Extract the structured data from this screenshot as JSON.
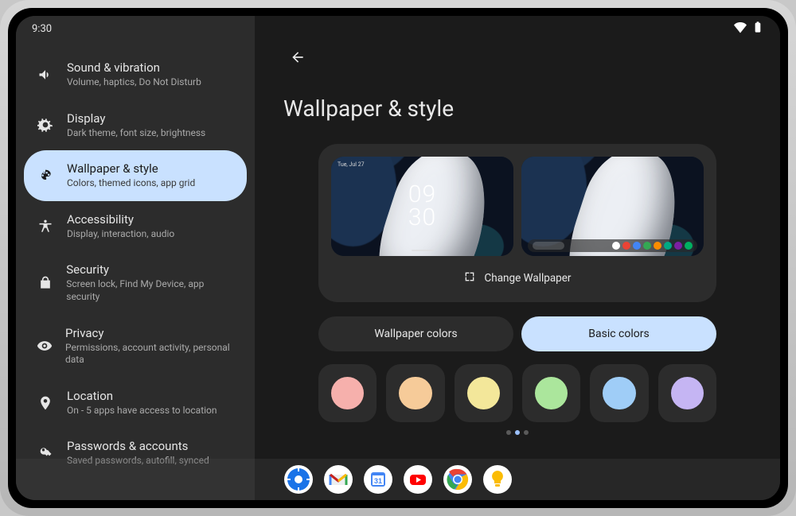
{
  "status": {
    "time": "9:30"
  },
  "sidebar": {
    "items": [
      {
        "key": "sound",
        "title": "Sound & vibration",
        "subtitle": "Volume, haptics, Do Not Disturb"
      },
      {
        "key": "display",
        "title": "Display",
        "subtitle": "Dark theme, font size, brightness"
      },
      {
        "key": "wallpaper",
        "title": "Wallpaper & style",
        "subtitle": "Colors, themed icons, app grid",
        "selected": true
      },
      {
        "key": "a11y",
        "title": "Accessibility",
        "subtitle": "Display, interaction, audio"
      },
      {
        "key": "security",
        "title": "Security",
        "subtitle": "Screen lock, Find My Device, app security"
      },
      {
        "key": "privacy",
        "title": "Privacy",
        "subtitle": "Permissions, account activity, personal data"
      },
      {
        "key": "location",
        "title": "Location",
        "subtitle": "On - 5 apps have access to location"
      },
      {
        "key": "passwords",
        "title": "Passwords & accounts",
        "subtitle": "Saved passwords, autofill, synced"
      }
    ]
  },
  "main": {
    "title": "Wallpaper & style",
    "lock_preview": {
      "time_top": "09",
      "time_bottom": "30",
      "date": "Tue, Jul 27"
    },
    "change_label": "Change Wallpaper",
    "tabs": {
      "wallpaper_colors": "Wallpaper colors",
      "basic_colors": "Basic colors",
      "active": "basic"
    },
    "swatches": [
      "#f6b0ac",
      "#f6cb99",
      "#f3e79a",
      "#abe69c",
      "#9fcdf7",
      "#c5b5f3"
    ],
    "pager": {
      "count": 3,
      "active": 1
    }
  },
  "home_dock_icons": [
    "#ffffff",
    "#ea4335",
    "#4285f4",
    "#34a853",
    "#fb8c00",
    "#00a884",
    "#7b1fa2",
    "#00b060"
  ],
  "taskbar_apps": [
    "settings",
    "gmail",
    "calendar",
    "youtube",
    "chrome",
    "keep"
  ]
}
